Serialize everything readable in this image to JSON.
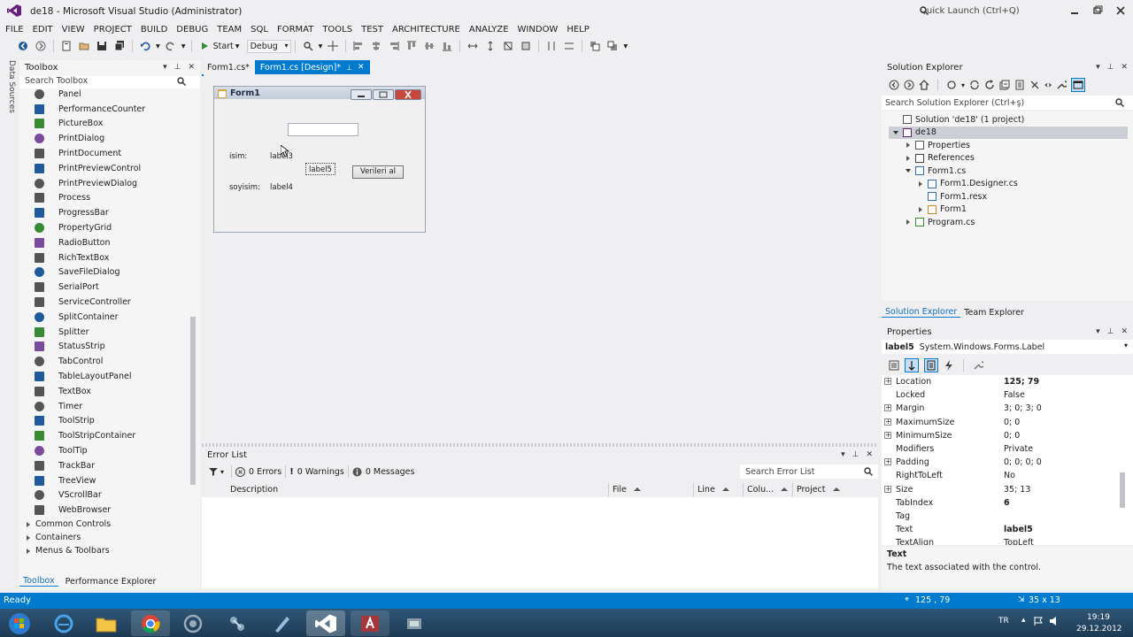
{
  "window": {
    "title": "de18 - Microsoft Visual Studio (Administrator)",
    "quick_launch_placeholder": "Quick Launch (Ctrl+Q)"
  },
  "menu": [
    "FILE",
    "EDIT",
    "VIEW",
    "PROJECT",
    "BUILD",
    "DEBUG",
    "TEAM",
    "SQL",
    "FORMAT",
    "TOOLS",
    "TEST",
    "ARCHITECTURE",
    "ANALYZE",
    "WINDOW",
    "HELP"
  ],
  "toolbar": {
    "start_label": "Start",
    "config": "Debug"
  },
  "side_strip": "Data Sources",
  "toolbox": {
    "title": "Toolbox",
    "search_placeholder": "Search Toolbox",
    "items": [
      "Panel",
      "PerformanceCounter",
      "PictureBox",
      "PrintDialog",
      "PrintDocument",
      "PrintPreviewControl",
      "PrintPreviewDialog",
      "Process",
      "ProgressBar",
      "PropertyGrid",
      "RadioButton",
      "RichTextBox",
      "SaveFileDialog",
      "SerialPort",
      "ServiceController",
      "SplitContainer",
      "Splitter",
      "StatusStrip",
      "TabControl",
      "TableLayoutPanel",
      "TextBox",
      "Timer",
      "ToolStrip",
      "ToolStripContainer",
      "ToolTip",
      "TrackBar",
      "TreeView",
      "VScrollBar",
      "WebBrowser"
    ],
    "categories": [
      "Common Controls",
      "Containers",
      "Menus & Toolbars"
    ],
    "bottom_tabs": [
      "Toolbox",
      "Performance Explorer"
    ]
  },
  "editor": {
    "tabs": [
      "Form1.cs*",
      "Form1.cs [Design]*"
    ],
    "form": {
      "title": "Form1",
      "label_isim": "isim:",
      "label3": "label3",
      "label5": "label5",
      "label_soyisim": "soyisim:",
      "label4": "label4",
      "button": "Verileri al"
    }
  },
  "error_list": {
    "title": "Error List",
    "errors": "0 Errors",
    "warnings": "0 Warnings",
    "messages": "0 Messages",
    "search_placeholder": "Search Error List",
    "columns": [
      "Description",
      "File",
      "Line",
      "Colu...",
      "Project"
    ]
  },
  "solution_explorer": {
    "title": "Solution Explorer",
    "search_placeholder": "Search Solution Explorer (Ctrl+ş)",
    "tree": [
      {
        "label": "Solution 'de18' (1 project)",
        "depth": 0,
        "expander": "none"
      },
      {
        "label": "de18",
        "depth": 0,
        "expander": "open"
      },
      {
        "label": "Properties",
        "depth": 1,
        "expander": "closed"
      },
      {
        "label": "References",
        "depth": 1,
        "expander": "closed"
      },
      {
        "label": "Form1.cs",
        "depth": 1,
        "expander": "open"
      },
      {
        "label": "Form1.Designer.cs",
        "depth": 2,
        "expander": "closed"
      },
      {
        "label": "Form1.resx",
        "depth": 2,
        "expander": "none"
      },
      {
        "label": "Form1",
        "depth": 2,
        "expander": "closed"
      },
      {
        "label": "Program.cs",
        "depth": 1,
        "expander": "closed"
      }
    ],
    "tabs": [
      "Solution Explorer",
      "Team Explorer"
    ]
  },
  "properties": {
    "title": "Properties",
    "object_name": "label5",
    "object_type": "System.Windows.Forms.Label",
    "rows": [
      {
        "name": "Location",
        "value": "125; 79",
        "expand": true,
        "bold": true
      },
      {
        "name": "Locked",
        "value": "False",
        "expand": false,
        "bold": false
      },
      {
        "name": "Margin",
        "value": "3; 0; 3; 0",
        "expand": true,
        "bold": false
      },
      {
        "name": "MaximumSize",
        "value": "0; 0",
        "expand": true,
        "bold": false
      },
      {
        "name": "MinimumSize",
        "value": "0; 0",
        "expand": true,
        "bold": false
      },
      {
        "name": "Modifiers",
        "value": "Private",
        "expand": false,
        "bold": false
      },
      {
        "name": "Padding",
        "value": "0; 0; 0; 0",
        "expand": true,
        "bold": false
      },
      {
        "name": "RightToLeft",
        "value": "No",
        "expand": false,
        "bold": false
      },
      {
        "name": "Size",
        "value": "35; 13",
        "expand": true,
        "bold": false
      },
      {
        "name": "TabIndex",
        "value": "6",
        "expand": false,
        "bold": true
      },
      {
        "name": "Tag",
        "value": "",
        "expand": false,
        "bold": false
      },
      {
        "name": "Text",
        "value": "label5",
        "expand": false,
        "bold": true
      },
      {
        "name": "TextAlign",
        "value": "TopLeft",
        "expand": false,
        "bold": false
      }
    ],
    "desc_title": "Text",
    "desc_text": "The text associated with the control."
  },
  "status": {
    "text": "Ready",
    "position": "125 , 79",
    "size": "35 x 13"
  },
  "taskbar": {
    "lang": "TR",
    "time": "19:19",
    "date": "29.12.2012"
  },
  "colors": {
    "accent": "#007acc",
    "chrome": "#efeff2",
    "panel": "#f5f5f5"
  }
}
